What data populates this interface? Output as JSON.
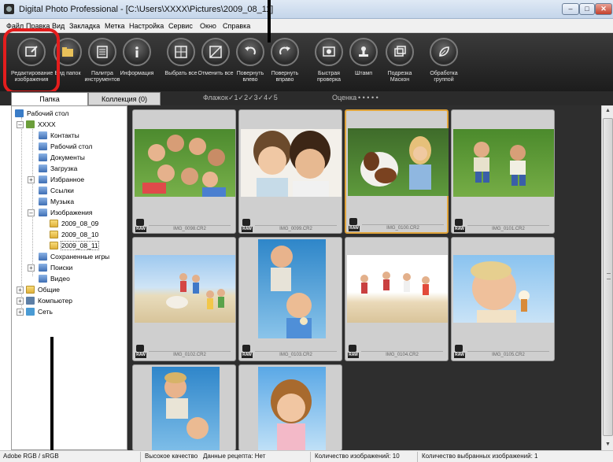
{
  "window": {
    "title": "Digital Photo Professional - [C:\\Users\\XXXX\\Pictures\\2009_08_11]",
    "min": "–",
    "max": "□",
    "close": "✕"
  },
  "menu": [
    "Файл",
    "Правка",
    "Вид",
    "Закладка",
    "Метка",
    "Настройка",
    "Сервис",
    "Окно",
    "Справка"
  ],
  "toolbar": [
    {
      "label": "Редактирование изображения",
      "icon": "edit-image-icon"
    },
    {
      "label": "Вид папок",
      "icon": "folder-view-icon"
    },
    {
      "label": "Палитра инструментов",
      "icon": "tool-palette-icon"
    },
    {
      "label": "Информация",
      "icon": "info-icon"
    },
    {
      "label": "Выбрать все",
      "icon": "select-all-icon"
    },
    {
      "label": "Отменить все",
      "icon": "deselect-all-icon"
    },
    {
      "label": "Повернуть влево",
      "icon": "rotate-left-icon"
    },
    {
      "label": "Повернуть вправо",
      "icon": "rotate-right-icon"
    },
    {
      "label": "Быстрая проверка",
      "icon": "quick-check-icon"
    },
    {
      "label": "Штамп",
      "icon": "stamp-icon"
    },
    {
      "label": "Подрезка Маскон",
      "icon": "trim-icon"
    },
    {
      "label": "Обработка группой",
      "icon": "batch-process-icon"
    }
  ],
  "tabs": {
    "folder": "Папка",
    "collection": "Коллекция (0)"
  },
  "filter": {
    "flag_label": "Флажок",
    "flags": "✓1✓2✓3✓4✓5",
    "rating_label": "Оценка",
    "rating_dots": "• • • • •"
  },
  "tree": [
    {
      "label": "Рабочий стол",
      "icon": "desk"
    },
    {
      "label": "XXXX",
      "icon": "user"
    },
    {
      "label": "Контакты",
      "icon": "special"
    },
    {
      "label": "Рабочий стол",
      "icon": "special"
    },
    {
      "label": "Документы",
      "icon": "special"
    },
    {
      "label": "Загрузка",
      "icon": "special"
    },
    {
      "label": "Избранное",
      "icon": "special"
    },
    {
      "label": "Ссылки",
      "icon": "special"
    },
    {
      "label": "Музыка",
      "icon": "special"
    },
    {
      "label": "Изображения",
      "icon": "special"
    },
    {
      "label": "2009_08_09",
      "icon": "folder"
    },
    {
      "label": "2009_08_10",
      "icon": "folder"
    },
    {
      "label": "2009_08_11",
      "icon": "folder"
    },
    {
      "label": "Сохраненные игры",
      "icon": "special"
    },
    {
      "label": "Поиски",
      "icon": "special"
    },
    {
      "label": "Видео",
      "icon": "special"
    },
    {
      "label": "Общие",
      "icon": "folder"
    },
    {
      "label": "Компьютер",
      "icon": "comp"
    },
    {
      "label": "Сеть",
      "icon": "net"
    }
  ],
  "thumbnails": [
    {
      "name": "IMG_0098.CR2",
      "raw": "RAW",
      "scene": "kids-circle"
    },
    {
      "name": "IMG_0099.CR2",
      "raw": "RAW",
      "scene": "two-kids"
    },
    {
      "name": "IMG_0100.CR2",
      "raw": "RAW",
      "scene": "girl-dog"
    },
    {
      "name": "IMG_0101.CR2",
      "raw": "RAW",
      "scene": "kids-grass"
    },
    {
      "name": "IMG_0102.CR2",
      "raw": "RAW",
      "scene": "beach-group"
    },
    {
      "name": "IMG_0103.CR2",
      "raw": "RAW",
      "scene": "boy-icecream-tall"
    },
    {
      "name": "IMG_0104.CR2",
      "raw": "RAW",
      "scene": "beach-run"
    },
    {
      "name": "IMG_0105.CR2",
      "raw": "RAW",
      "scene": "boy-icecream"
    },
    {
      "name": "",
      "raw": "",
      "scene": "boy-sky"
    },
    {
      "name": "",
      "raw": "",
      "scene": "girl-sky"
    }
  ],
  "status": {
    "color_space": "Adobe RGB / sRGB",
    "quality": "Высокое качество",
    "recipe": "Данные рецепта: Нет",
    "count": "Количество изображений: 10",
    "selected": "Количество выбранных изображений: 1"
  }
}
